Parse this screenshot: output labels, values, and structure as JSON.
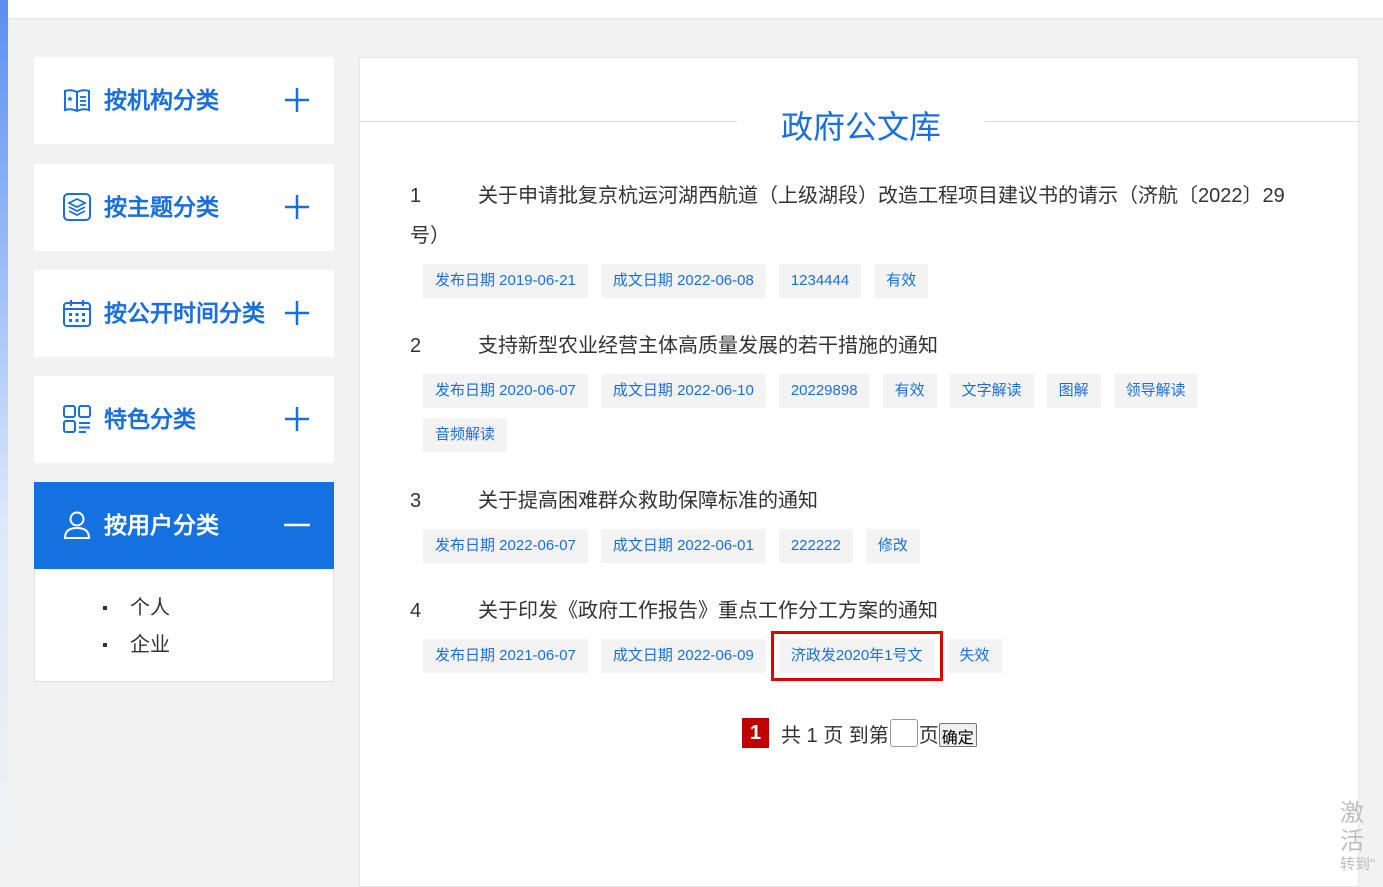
{
  "sidebar": {
    "items": [
      {
        "label": "按机构分类",
        "icon": "org-book-icon",
        "toggle": "plus"
      },
      {
        "label": "按主题分类",
        "icon": "layers-icon",
        "toggle": "plus"
      },
      {
        "label": "按公开时间分类",
        "icon": "calendar-icon",
        "toggle": "plus"
      },
      {
        "label": "特色分类",
        "icon": "grid-list-icon",
        "toggle": "plus"
      },
      {
        "label": "按用户分类",
        "icon": "user-icon",
        "toggle": "minus"
      }
    ],
    "sub_items": [
      "个人",
      "企业"
    ]
  },
  "main": {
    "title": "政府公文库",
    "docs": [
      {
        "num": "1",
        "title": "关于申请批复京杭运河湖西航道（上级湖段）改造工程项目建议书的请示（济航〔2022〕29号）",
        "tags": [
          "发布日期 2019-06-21",
          "成文日期 2022-06-08",
          "1234444",
          "有效"
        ]
      },
      {
        "num": "2",
        "title": "支持新型农业经营主体高质量发展的若干措施的通知",
        "tags": [
          "发布日期 2020-06-07",
          "成文日期 2022-06-10",
          "20229898",
          "有效",
          "文字解读",
          "图解",
          "领导解读",
          "音频解读"
        ]
      },
      {
        "num": "3",
        "title": "关于提高困难群众救助保障标准的通知",
        "tags": [
          "发布日期 2022-06-07",
          "成文日期 2022-06-01",
          "222222",
          "修改"
        ]
      },
      {
        "num": "4",
        "title": "关于印发《政府工作报告》重点工作分工方案的通知",
        "tags": [
          "发布日期 2021-06-07",
          "成文日期 2022-06-09",
          "济政发2020年1号文",
          "失效"
        ]
      }
    ]
  },
  "pager": {
    "current": "1",
    "total_text": "共 1 页 到第",
    "suffix": "页",
    "confirm": "确定"
  },
  "watermark": {
    "line1": "激活",
    "line2": "转到\""
  },
  "colors": {
    "accent": "#1a6fdc",
    "active_bg": "#1570e0",
    "page_num": "#c00000",
    "highlight": "#e00000"
  }
}
